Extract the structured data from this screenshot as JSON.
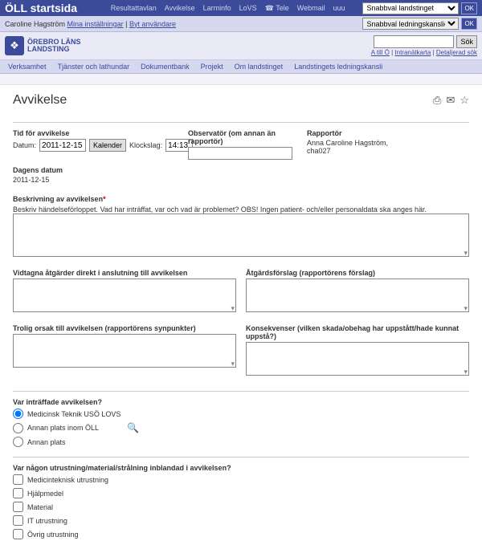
{
  "topbar": {
    "title": "ÖLL startsida",
    "links": [
      "Resultattavlan",
      "Avvikelse",
      "Larminfo",
      "LoVS",
      "Tele",
      "Webmail",
      "uuu"
    ],
    "dropdown1": "Snabbval landstinget",
    "ok": "OK"
  },
  "userbar": {
    "name": "Caroline Hagström",
    "link1": "Mina inställningar",
    "sep": " | ",
    "link2": "Byt användare",
    "dropdown2": "Snabbval ledningskansliet",
    "ok": "OK"
  },
  "logo": {
    "line1": "ÖREBRO LÄNS",
    "line2": "LANDSTING",
    "glyph": "❖"
  },
  "search": {
    "placeholder": "",
    "button": "Sök",
    "links": [
      "A till Ö",
      "Intranätkarta",
      "Detaljerad sök"
    ]
  },
  "nav": [
    "Verksamhet",
    "Tjänster och lathundar",
    "Dokumentbank",
    "Projekt",
    "Om landstinget",
    "Landstingets ledningskansli"
  ],
  "page": {
    "title": "Avvikelse"
  },
  "row1": {
    "tid_hdr": "Tid för avvikelse",
    "datum_lbl": "Datum:",
    "datum_val": "2011-12-15",
    "kalender": "Kalender",
    "klock_lbl": "Klockslag:",
    "klock_val": "14:13",
    "obs_hdr": "Observatör (om annan än rapportör)",
    "obs_val": "",
    "rap_hdr": "Rapportör",
    "rap_val": "Anna Caroline Hagström, cha027",
    "dag_hdr": "Dagens datum",
    "dag_val": "2011-12-15"
  },
  "beskriv": {
    "hdr": "Beskrivning av avvikelsen",
    "desc": "Beskriv händelseförloppet. Vad har inträffat, var och vad är problemet? OBS! Ingen patient- och/eller personaldata ska anges här."
  },
  "vidtagna": {
    "hdr": "Vidtagna åtgärder direkt i anslutning till avvikelsen"
  },
  "atgard": {
    "hdr": "Åtgärdsförslag (rapportörens förslag)"
  },
  "trolig": {
    "hdr": "Trolig orsak till avvikelsen (rapportörens synpunkter)"
  },
  "konsek": {
    "hdr": "Konsekvenser (vilken skada/obehag har uppstått/hade kunnat uppstå?)"
  },
  "varintr": {
    "hdr": "Var inträffade avvikelsen?",
    "opt1": "Medicinsk Teknik USÖ LOVS",
    "opt2": "Annan plats inom ÖLL",
    "opt3": "Annan plats"
  },
  "utrust": {
    "hdr": "Var någon utrustning/material/strålning inblandad i avvikelsen?",
    "opts": [
      "Medicinteknisk utrustning",
      "Hjälpmedel",
      "Material",
      "IT utrustning",
      "Övrig utrustning"
    ]
  },
  "icons": {
    "print": "⎙",
    "mail": "✉",
    "star": "☆",
    "magnify": "🔍",
    "tele": "☎"
  }
}
